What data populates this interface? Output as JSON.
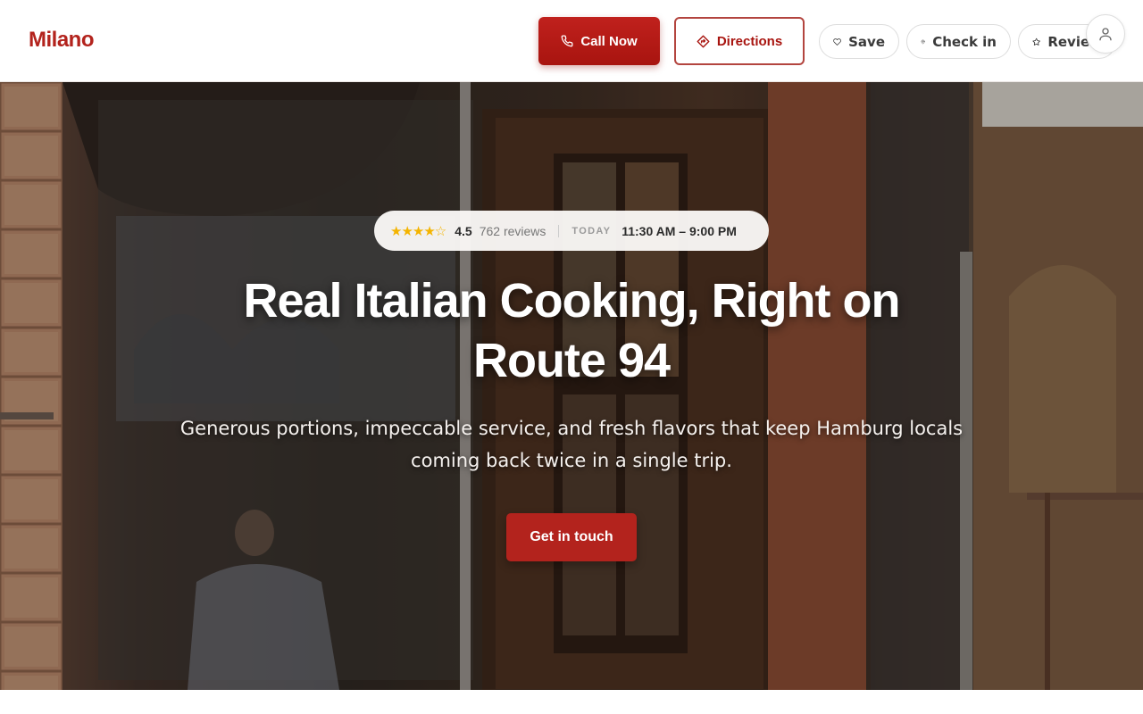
{
  "brand": {
    "name": "Milano"
  },
  "header": {
    "call_label": "Call Now",
    "directions_label": "Directions",
    "save_label": "Save",
    "checkin_label": "Check in",
    "review_label": "Review"
  },
  "hero": {
    "stars": "★★★★☆",
    "rating": "4.5",
    "reviews": "762 reviews",
    "today_label": "TODAY",
    "hours": "11:30 AM – 9:00 PM",
    "title": "Real Italian Cooking, Right on Route 94",
    "subtitle": "Generous portions, impeccable service, and fresh flavors that keep Hamburg locals coming back twice in a single trip.",
    "cta_label": "Get in touch"
  },
  "colors": {
    "brand": "#b3231d",
    "star": "#f4b400"
  },
  "icons": {
    "call": "phone-icon",
    "directions": "directions-icon",
    "save": "heart-icon",
    "checkin": "map-pin-icon",
    "review": "star-icon",
    "account": "user-icon"
  }
}
